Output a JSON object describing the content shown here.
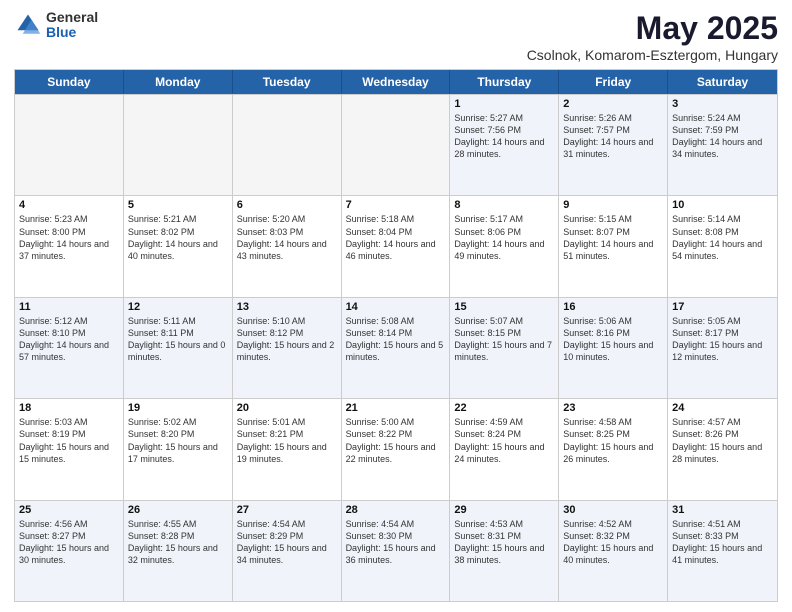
{
  "header": {
    "logo_general": "General",
    "logo_blue": "Blue",
    "title": "May 2025",
    "location": "Csolnok, Komarom-Esztergom, Hungary"
  },
  "days_of_week": [
    "Sunday",
    "Monday",
    "Tuesday",
    "Wednesday",
    "Thursday",
    "Friday",
    "Saturday"
  ],
  "rows": [
    [
      {
        "day": "",
        "info": "",
        "empty": true
      },
      {
        "day": "",
        "info": "",
        "empty": true
      },
      {
        "day": "",
        "info": "",
        "empty": true
      },
      {
        "day": "",
        "info": "",
        "empty": true
      },
      {
        "day": "1",
        "info": "Sunrise: 5:27 AM\nSunset: 7:56 PM\nDaylight: 14 hours and 28 minutes.",
        "empty": false
      },
      {
        "day": "2",
        "info": "Sunrise: 5:26 AM\nSunset: 7:57 PM\nDaylight: 14 hours and 31 minutes.",
        "empty": false
      },
      {
        "day": "3",
        "info": "Sunrise: 5:24 AM\nSunset: 7:59 PM\nDaylight: 14 hours and 34 minutes.",
        "empty": false
      }
    ],
    [
      {
        "day": "4",
        "info": "Sunrise: 5:23 AM\nSunset: 8:00 PM\nDaylight: 14 hours and 37 minutes.",
        "empty": false
      },
      {
        "day": "5",
        "info": "Sunrise: 5:21 AM\nSunset: 8:02 PM\nDaylight: 14 hours and 40 minutes.",
        "empty": false
      },
      {
        "day": "6",
        "info": "Sunrise: 5:20 AM\nSunset: 8:03 PM\nDaylight: 14 hours and 43 minutes.",
        "empty": false
      },
      {
        "day": "7",
        "info": "Sunrise: 5:18 AM\nSunset: 8:04 PM\nDaylight: 14 hours and 46 minutes.",
        "empty": false
      },
      {
        "day": "8",
        "info": "Sunrise: 5:17 AM\nSunset: 8:06 PM\nDaylight: 14 hours and 49 minutes.",
        "empty": false
      },
      {
        "day": "9",
        "info": "Sunrise: 5:15 AM\nSunset: 8:07 PM\nDaylight: 14 hours and 51 minutes.",
        "empty": false
      },
      {
        "day": "10",
        "info": "Sunrise: 5:14 AM\nSunset: 8:08 PM\nDaylight: 14 hours and 54 minutes.",
        "empty": false
      }
    ],
    [
      {
        "day": "11",
        "info": "Sunrise: 5:12 AM\nSunset: 8:10 PM\nDaylight: 14 hours and 57 minutes.",
        "empty": false
      },
      {
        "day": "12",
        "info": "Sunrise: 5:11 AM\nSunset: 8:11 PM\nDaylight: 15 hours and 0 minutes.",
        "empty": false
      },
      {
        "day": "13",
        "info": "Sunrise: 5:10 AM\nSunset: 8:12 PM\nDaylight: 15 hours and 2 minutes.",
        "empty": false
      },
      {
        "day": "14",
        "info": "Sunrise: 5:08 AM\nSunset: 8:14 PM\nDaylight: 15 hours and 5 minutes.",
        "empty": false
      },
      {
        "day": "15",
        "info": "Sunrise: 5:07 AM\nSunset: 8:15 PM\nDaylight: 15 hours and 7 minutes.",
        "empty": false
      },
      {
        "day": "16",
        "info": "Sunrise: 5:06 AM\nSunset: 8:16 PM\nDaylight: 15 hours and 10 minutes.",
        "empty": false
      },
      {
        "day": "17",
        "info": "Sunrise: 5:05 AM\nSunset: 8:17 PM\nDaylight: 15 hours and 12 minutes.",
        "empty": false
      }
    ],
    [
      {
        "day": "18",
        "info": "Sunrise: 5:03 AM\nSunset: 8:19 PM\nDaylight: 15 hours and 15 minutes.",
        "empty": false
      },
      {
        "day": "19",
        "info": "Sunrise: 5:02 AM\nSunset: 8:20 PM\nDaylight: 15 hours and 17 minutes.",
        "empty": false
      },
      {
        "day": "20",
        "info": "Sunrise: 5:01 AM\nSunset: 8:21 PM\nDaylight: 15 hours and 19 minutes.",
        "empty": false
      },
      {
        "day": "21",
        "info": "Sunrise: 5:00 AM\nSunset: 8:22 PM\nDaylight: 15 hours and 22 minutes.",
        "empty": false
      },
      {
        "day": "22",
        "info": "Sunrise: 4:59 AM\nSunset: 8:24 PM\nDaylight: 15 hours and 24 minutes.",
        "empty": false
      },
      {
        "day": "23",
        "info": "Sunrise: 4:58 AM\nSunset: 8:25 PM\nDaylight: 15 hours and 26 minutes.",
        "empty": false
      },
      {
        "day": "24",
        "info": "Sunrise: 4:57 AM\nSunset: 8:26 PM\nDaylight: 15 hours and 28 minutes.",
        "empty": false
      }
    ],
    [
      {
        "day": "25",
        "info": "Sunrise: 4:56 AM\nSunset: 8:27 PM\nDaylight: 15 hours and 30 minutes.",
        "empty": false
      },
      {
        "day": "26",
        "info": "Sunrise: 4:55 AM\nSunset: 8:28 PM\nDaylight: 15 hours and 32 minutes.",
        "empty": false
      },
      {
        "day": "27",
        "info": "Sunrise: 4:54 AM\nSunset: 8:29 PM\nDaylight: 15 hours and 34 minutes.",
        "empty": false
      },
      {
        "day": "28",
        "info": "Sunrise: 4:54 AM\nSunset: 8:30 PM\nDaylight: 15 hours and 36 minutes.",
        "empty": false
      },
      {
        "day": "29",
        "info": "Sunrise: 4:53 AM\nSunset: 8:31 PM\nDaylight: 15 hours and 38 minutes.",
        "empty": false
      },
      {
        "day": "30",
        "info": "Sunrise: 4:52 AM\nSunset: 8:32 PM\nDaylight: 15 hours and 40 minutes.",
        "empty": false
      },
      {
        "day": "31",
        "info": "Sunrise: 4:51 AM\nSunset: 8:33 PM\nDaylight: 15 hours and 41 minutes.",
        "empty": false
      }
    ]
  ]
}
